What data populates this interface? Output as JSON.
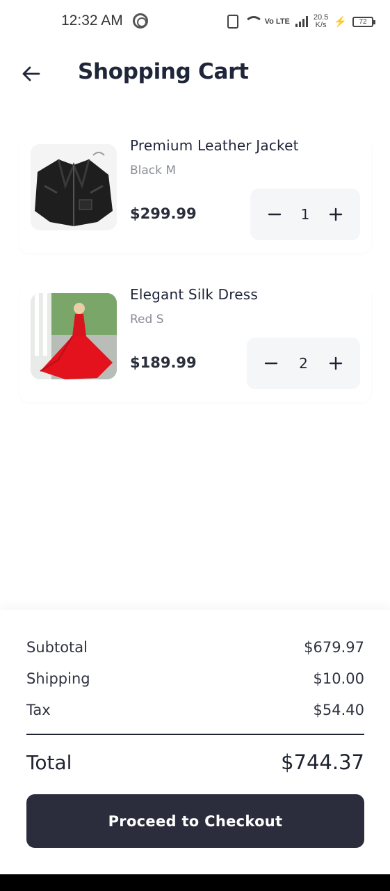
{
  "status_bar": {
    "time": "12:32 AM",
    "network_lte": "Vo LTE",
    "speed_value": "20.5",
    "speed_unit": "K/s",
    "battery": "72"
  },
  "header": {
    "title": "Shopping Cart",
    "back_icon": "arrow-left-icon"
  },
  "cart": {
    "items": [
      {
        "name": "Premium Leather Jacket",
        "variant": "Black M",
        "price": "$299.99",
        "quantity": "1",
        "decrease_icon": "minus-icon",
        "increase_icon": "plus-icon"
      },
      {
        "name": "Elegant Silk Dress",
        "variant": "Red S",
        "price": "$189.99",
        "quantity": "2",
        "decrease_icon": "minus-icon",
        "increase_icon": "plus-icon"
      }
    ]
  },
  "summary": {
    "subtotal_label": "Subtotal",
    "subtotal_value": "$679.97",
    "shipping_label": "Shipping",
    "shipping_value": "$10.00",
    "tax_label": "Tax",
    "tax_value": "$54.40",
    "total_label": "Total",
    "total_value": "$744.37",
    "checkout_label": "Proceed to Checkout"
  },
  "colors": {
    "primary_button": "#2b2d3d",
    "text_dark": "#20263a",
    "text_muted": "#8a8d96",
    "qty_background": "#f5f6f8"
  }
}
